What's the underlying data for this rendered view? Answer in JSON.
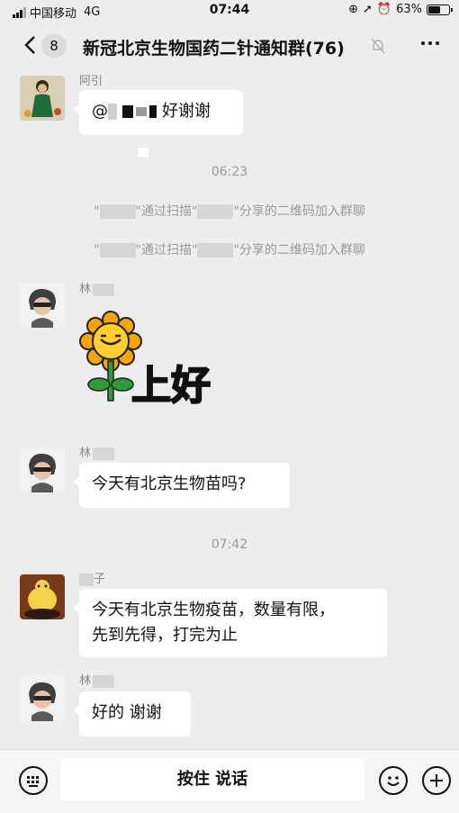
{
  "status": {
    "carrier": "中国移动",
    "network": "4G",
    "time": "07:44",
    "battery": "63%",
    "battery_level": 0.63
  },
  "header": {
    "unread_count": "8",
    "title": "新冠北京生物国药二针通知群(76)"
  },
  "messages": {
    "m1": {
      "nickname": "阿引",
      "text_prefix": "@",
      "text_suffix": "好谢谢"
    },
    "time1": "06:23",
    "sys1": {
      "quote_open": "\"",
      "part1": "\"通过扫描\"",
      "part2": "\"分享的二维码加入群聊"
    },
    "sys2": {
      "quote_open": "\"",
      "part1": "\"通过扫描\"",
      "part2": "\"分享的二维码加入群聊"
    },
    "m2": {
      "nickname": "林",
      "sticker_text": "上好"
    },
    "m3": {
      "nickname": "林",
      "text": "今天有北京生物苗吗?"
    },
    "time2": "07:42",
    "m4": {
      "nickname": "子",
      "line1": "今天有北京生物疫苗，数量有限，",
      "line2": "先到先得，打完为止"
    },
    "m5": {
      "nickname": "林",
      "text": "好的 谢谢"
    }
  },
  "input": {
    "voice_label": "按住 说话"
  },
  "colors": {
    "background": "#ededed",
    "bubble": "#ffffff",
    "sticker_petal": "#f7a600",
    "sticker_stem": "#2e9a3a"
  }
}
